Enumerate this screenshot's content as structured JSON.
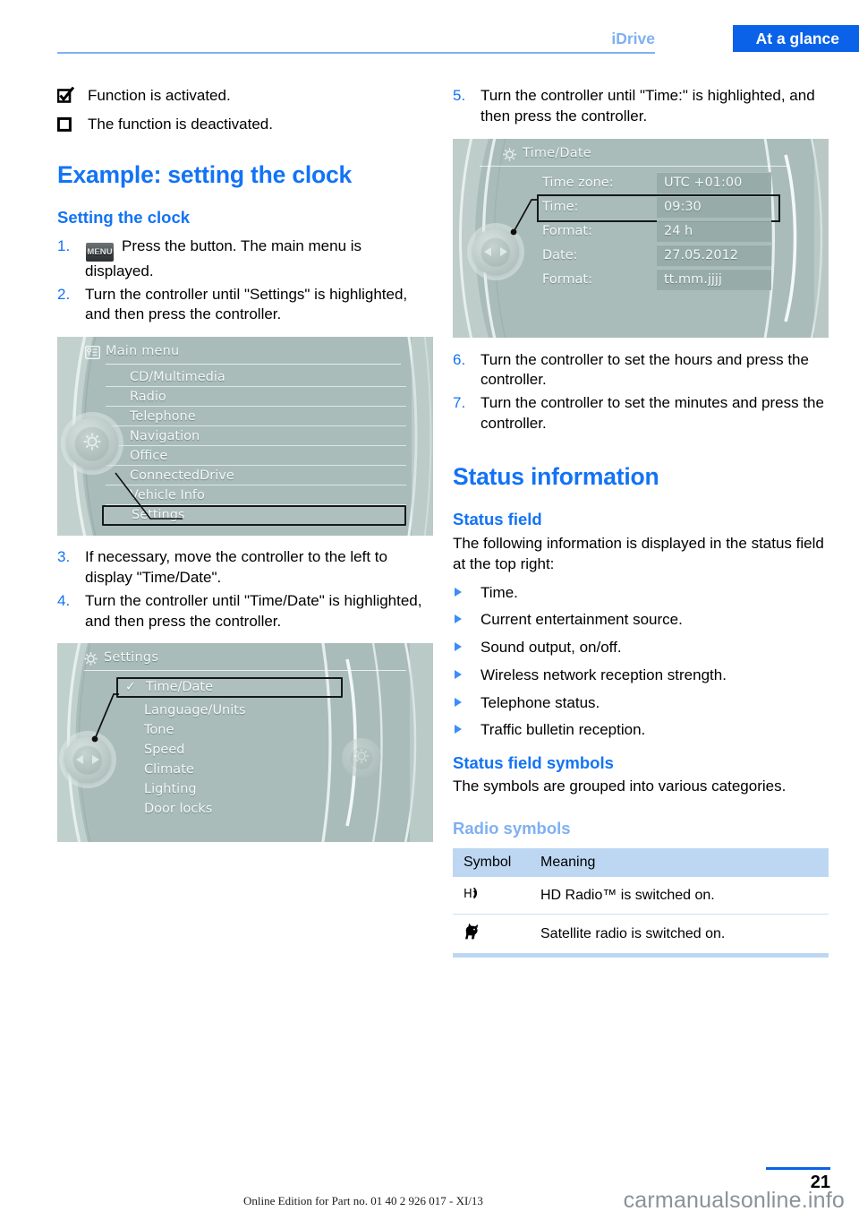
{
  "header": {
    "section": "iDrive",
    "tab": "At a glance"
  },
  "legend": [
    {
      "icon": "checkbox-checked-icon",
      "text": "Function is activated."
    },
    {
      "icon": "checkbox-empty-icon",
      "text": "The function is deactivated."
    }
  ],
  "left": {
    "heading": "Example: setting the clock",
    "subheading": "Setting the clock",
    "steps": [
      {
        "num": "1.",
        "chip": "MENU",
        "text": "Press the button. The main menu is displayed."
      },
      {
        "num": "2.",
        "text": "Turn the controller until \"Settings\" is highlighted, and then press the controller."
      },
      {
        "num": "3.",
        "text": "If necessary, move the controller to the left to display \"Time/Date\"."
      },
      {
        "num": "4.",
        "text": "Turn the controller until \"Time/Date\" is highlighted, and then press the controller."
      }
    ]
  },
  "screen_main_menu": {
    "title": "Main menu",
    "title_icon": "list-menu-icon",
    "knob_icon": "gear-icon",
    "items": [
      {
        "label": "CD/Multimedia",
        "selected": false
      },
      {
        "label": "Radio",
        "selected": false
      },
      {
        "label": "Telephone",
        "selected": false
      },
      {
        "label": "Navigation",
        "selected": false
      },
      {
        "label": "Office",
        "selected": false
      },
      {
        "label": "ConnectedDrive",
        "selected": false
      },
      {
        "label": "Vehicle Info",
        "selected": false
      },
      {
        "label": "Settings",
        "selected": true
      }
    ]
  },
  "screen_settings": {
    "title": "Settings",
    "title_icon": "gear-icon",
    "knob_icon": "left-right-arrows-icon",
    "side_icon": "gear-icon",
    "items": [
      {
        "label": "Time/Date",
        "selected": true,
        "check": "✓"
      },
      {
        "label": "Language/Units",
        "selected": false
      },
      {
        "label": "Tone",
        "selected": false
      },
      {
        "label": "Speed",
        "selected": false
      },
      {
        "label": "Climate",
        "selected": false
      },
      {
        "label": "Lighting",
        "selected": false
      },
      {
        "label": "Door locks",
        "selected": false
      }
    ]
  },
  "screen_time_date": {
    "title": "Time/Date",
    "title_icon": "gear-icon",
    "knob_icon": "left-right-arrows-icon",
    "rows": [
      {
        "label": "Time zone:",
        "value": "UTC +01:00",
        "selected": false
      },
      {
        "label": "Time:",
        "value": "09:30",
        "selected": true
      },
      {
        "label": "Format:",
        "value": "24 h",
        "selected": false
      },
      {
        "label": "Date:",
        "value": "27.05.2012",
        "selected": false
      },
      {
        "label": "Format:",
        "value": "tt.mm.jjjj",
        "selected": false
      }
    ]
  },
  "right": {
    "steps_top": [
      {
        "num": "5.",
        "text": "Turn the controller until \"Time:\" is highlighted, and then press the controller."
      }
    ],
    "steps_mid": [
      {
        "num": "6.",
        "text": "Turn the controller to set the hours and press the controller."
      },
      {
        "num": "7.",
        "text": "Turn the controller to set the minutes and press the controller."
      }
    ],
    "status_heading": "Status information",
    "status_field_sub": "Status field",
    "status_field_intro": "The following information is displayed in the status field at the top right:",
    "status_bullets": [
      "Time.",
      "Current entertainment source.",
      "Sound output, on/off.",
      "Wireless network reception strength.",
      "Telephone status.",
      "Traffic bulletin reception."
    ],
    "symbols_sub": "Status field symbols",
    "symbols_intro": "The symbols are grouped into various categories.",
    "radio_sub": "Radio symbols",
    "table": {
      "headers": [
        "Symbol",
        "Meaning"
      ],
      "rows": [
        {
          "symbol_icon": "hd-radio-icon",
          "meaning": "HD Radio™ is switched on."
        },
        {
          "symbol_icon": "satellite-radio-dog-icon",
          "meaning": "Satellite radio is switched on."
        }
      ]
    }
  },
  "footer": {
    "page_number": "21",
    "edition": "Online Edition for Part no. 01 40 2 926 017 - XI/13",
    "watermark": "carmanualsonline.info"
  },
  "colors": {
    "accent_blue": "#1373f5",
    "tab_blue": "#0a62e8",
    "light_blue": "#7fb0f2",
    "table_header": "#bdd7f2",
    "idrive_bg": "#a9bcb9"
  }
}
